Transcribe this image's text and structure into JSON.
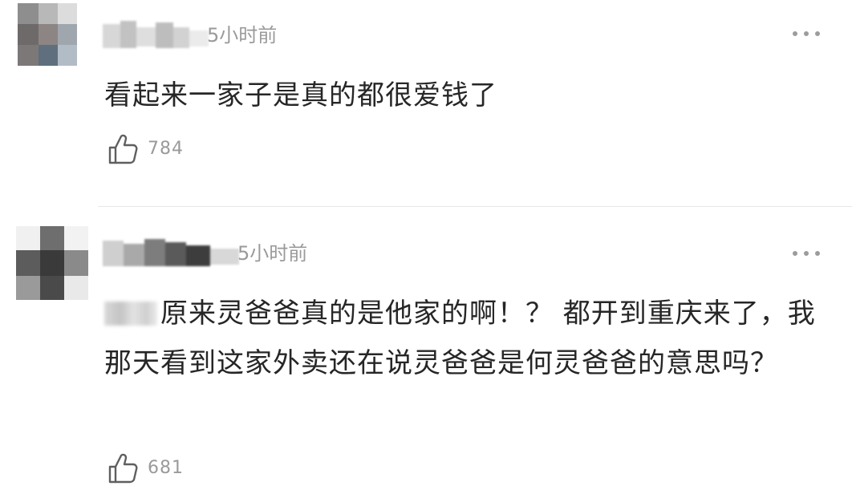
{
  "comments": [
    {
      "time": "5小时前",
      "text": "看起来一家子是真的都很爱钱了",
      "likes": "784",
      "avatar_icon": "user-avatar-pixelated",
      "more_icon": "more-dots-icon",
      "like_icon": "thumbs-up-icon"
    },
    {
      "time": "5小时前",
      "text": "原来灵爸爸真的是他家的啊！？ 都开到重庆来了，我那天看到这家外卖还在说灵爸爸是何灵爸爸的意思吗？",
      "likes": "681",
      "avatar_icon": "user-avatar-pixelated",
      "more_icon": "more-dots-icon",
      "like_icon": "thumbs-up-icon"
    }
  ],
  "colors": {
    "text": "#262626",
    "meta": "#9a9a9a",
    "divider": "#e6e6e6",
    "background": "#ffffff"
  }
}
